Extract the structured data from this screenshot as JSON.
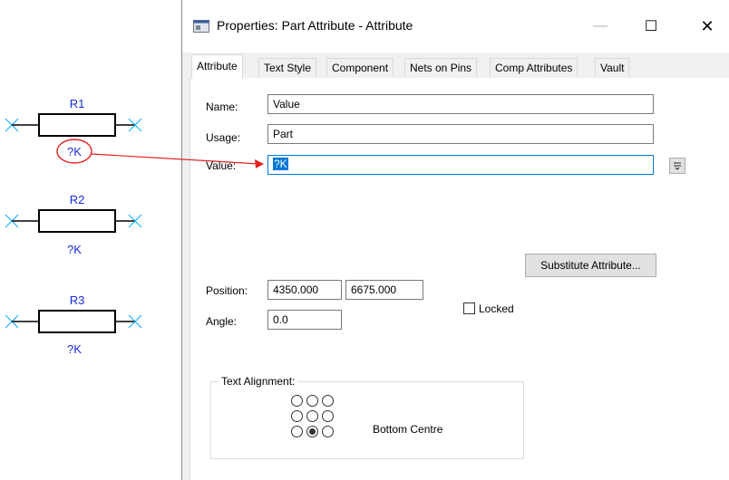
{
  "schematic": {
    "components": [
      {
        "ref": "R1",
        "value": "?K",
        "value_circled": true
      },
      {
        "ref": "R2",
        "value": "?K",
        "value_circled": false
      },
      {
        "ref": "R3",
        "value": "?K",
        "value_circled": false
      }
    ],
    "colors": {
      "body": "#000000",
      "pin_end": "#00aaff",
      "label": "#1a2cd8",
      "highlight": "#e02020"
    }
  },
  "dialog": {
    "title": "Properties: Part Attribute - Attribute",
    "app_icon": "dialog-icon",
    "window_buttons": {
      "minimize": "—",
      "maximize": "☐",
      "close": "✕"
    },
    "tabs": [
      {
        "label": "Attribute",
        "active": true
      },
      {
        "label": "Text Style",
        "active": false
      },
      {
        "label": "Component",
        "active": false
      },
      {
        "label": "Nets on Pins",
        "active": false
      },
      {
        "label": "Comp Attributes",
        "active": false
      },
      {
        "label": "Vault",
        "active": false
      }
    ],
    "fields": {
      "name_label": "Name:",
      "name_value": "Value",
      "usage_label": "Usage:",
      "usage_value": "Part",
      "value_label": "Value:",
      "value_value": "?K",
      "position_label": "Position:",
      "position_x": "4350.000",
      "position_y": "6675.000",
      "angle_label": "Angle:",
      "angle_value": "0.0"
    },
    "substitute_button": "Substitute Attribute...",
    "locked_label": "Locked",
    "locked_checked": false,
    "text_alignment": {
      "legend": "Text Alignment:",
      "selected": "Bottom Centre",
      "selected_index": 7
    }
  }
}
